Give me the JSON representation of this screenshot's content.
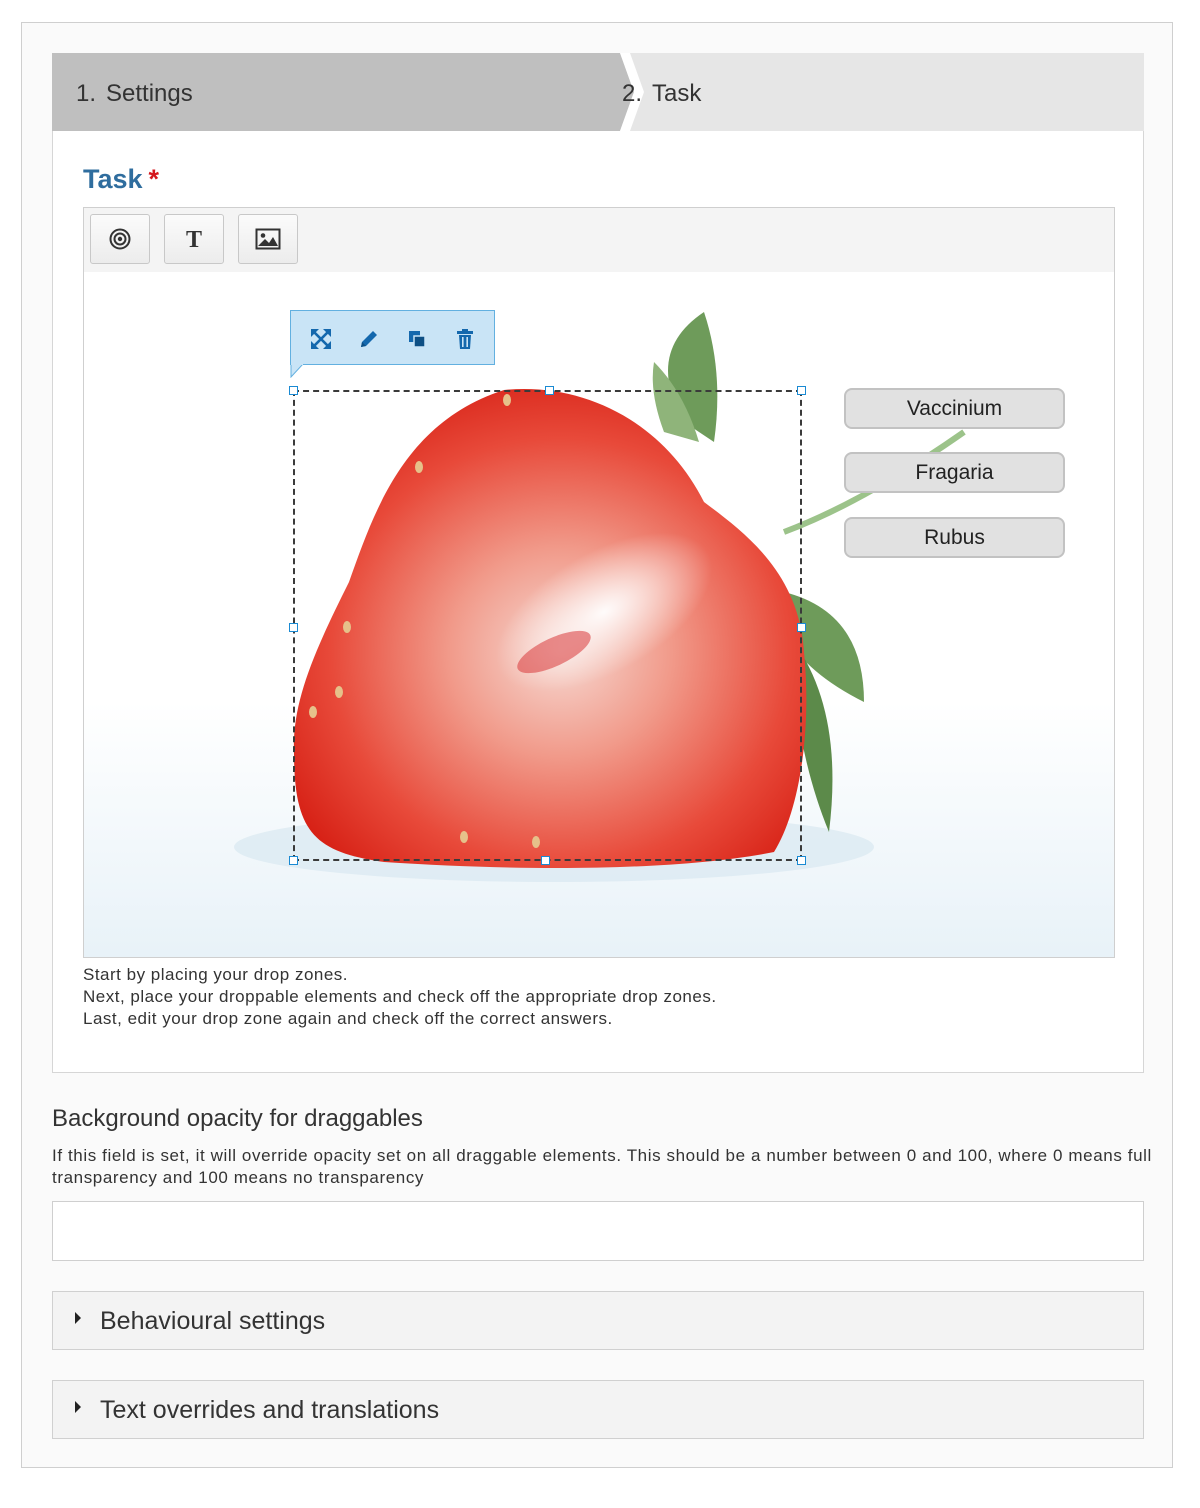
{
  "wizard": {
    "steps": [
      {
        "number": "1.",
        "label": "Settings"
      },
      {
        "number": "2.",
        "label": "Task"
      }
    ]
  },
  "task": {
    "title": "Task",
    "required_mark": "*"
  },
  "toolbar": {
    "buttons": [
      "dropzone-target-icon",
      "text-T-icon",
      "image-icon"
    ]
  },
  "dropzone_toolbar": {
    "buttons": [
      "expand-icon",
      "pencil-icon",
      "layers-icon",
      "trash-icon"
    ]
  },
  "draggables": [
    "Vaccinium",
    "Fragaria",
    "Rubus"
  ],
  "help_lines": [
    "Start by placing your drop zones.",
    "Next, place your droppable elements and check off the appropriate drop zones.",
    "Last, edit your drop zone again and check off the correct answers."
  ],
  "opacity": {
    "label": "Background opacity for draggables",
    "description": "If this field is set, it will override opacity set on all draggable elements. This should be a number between 0 and 100, where 0 means full transparency and 100 means no transparency",
    "value": ""
  },
  "sections": [
    {
      "label": "Behavioural settings"
    },
    {
      "label": "Text overrides and translations"
    }
  ],
  "colors": {
    "accent_title": "#2f6d9e",
    "required": "#d4171d",
    "dropzone_toolbar_bg": "#c9e4f6",
    "icon_blue": "#1468ad",
    "strawberry_red": "#e2231a"
  }
}
